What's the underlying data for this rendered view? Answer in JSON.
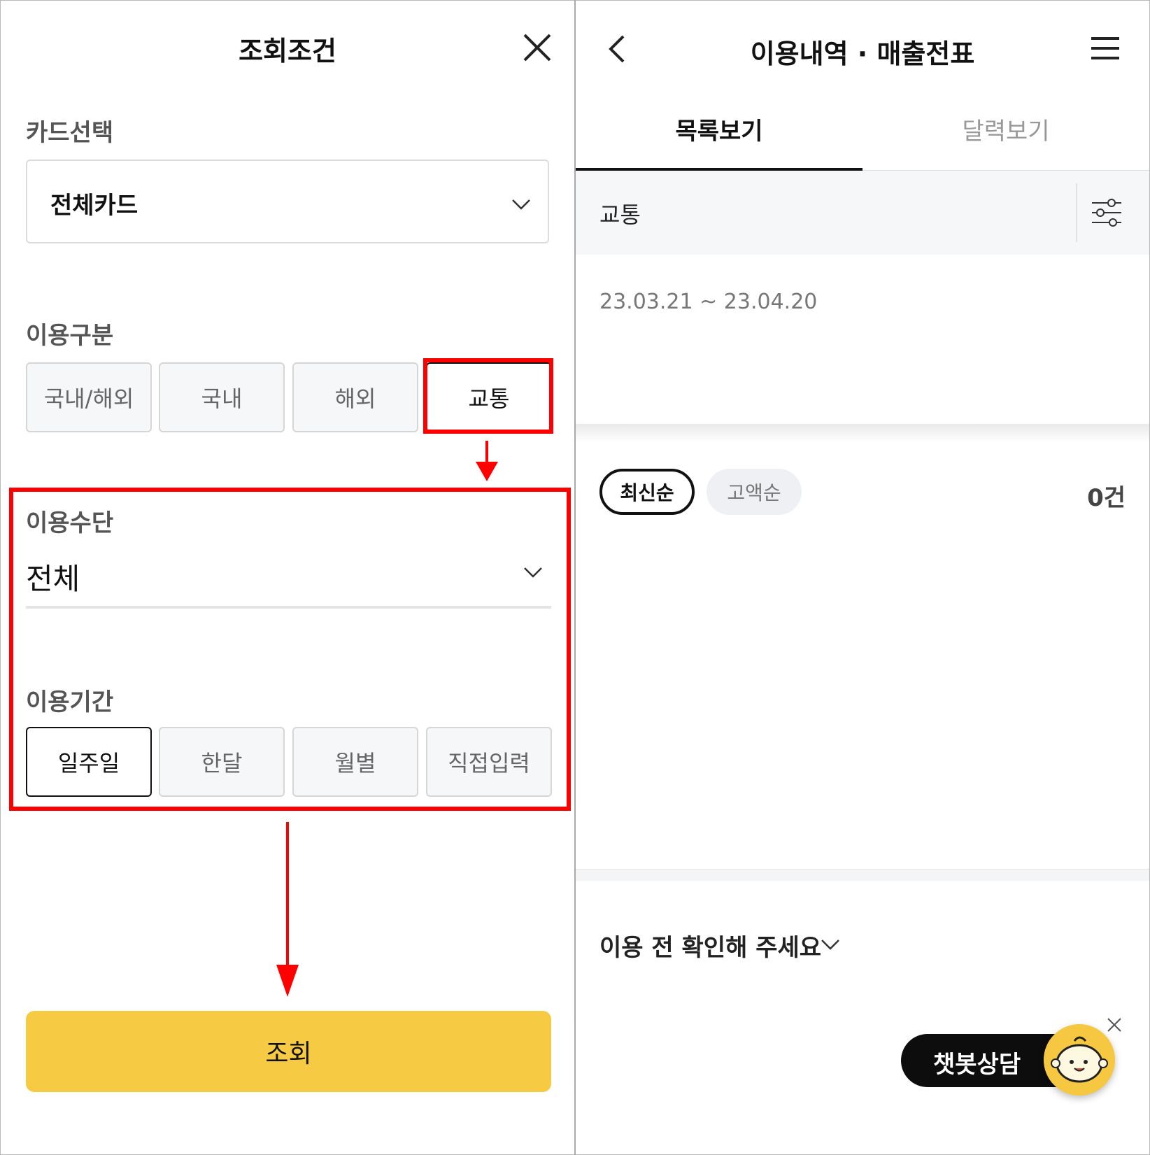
{
  "left_panel": {
    "title": "조회조건",
    "card_section": {
      "label": "카드선택",
      "value": "전체카드"
    },
    "usage_type": {
      "label": "이용구분",
      "options": [
        "국내/해외",
        "국내",
        "해외",
        "교통"
      ],
      "selected": "교통"
    },
    "usage_method": {
      "label": "이용수단",
      "value": "전체"
    },
    "usage_period": {
      "label": "이용기간",
      "options": [
        "일주일",
        "한달",
        "월별",
        "직접입력"
      ],
      "selected": "일주일"
    },
    "submit_label": "조회",
    "annotation_color": "#ff0000"
  },
  "right_panel": {
    "title": "이용내역 · 매출전표",
    "tabs": [
      {
        "label": "목록보기",
        "active": true
      },
      {
        "label": "달력보기",
        "active": false
      }
    ],
    "filter_text": "교통",
    "date_range": "23.03.21 ~ 23.04.20",
    "sort_options": [
      {
        "label": "최신순",
        "active": true
      },
      {
        "label": "고액순",
        "active": false
      }
    ],
    "count": "0건",
    "notice": "이용 전 확인해 주세요",
    "chatbot_label": "챗봇상담"
  },
  "colors": {
    "accent_yellow": "#f6cb43",
    "annotation_red": "#ff0000",
    "chatbot_bg": "#0d0d0d",
    "selected_border": "#111111"
  },
  "icons": {
    "close": "close-icon",
    "dropdown": "chevron-down-icon",
    "back": "chevron-left-icon",
    "menu": "hamburger-menu-icon",
    "filter": "filter-sliders-icon",
    "chatbot": "chatbot-mascot-icon"
  }
}
